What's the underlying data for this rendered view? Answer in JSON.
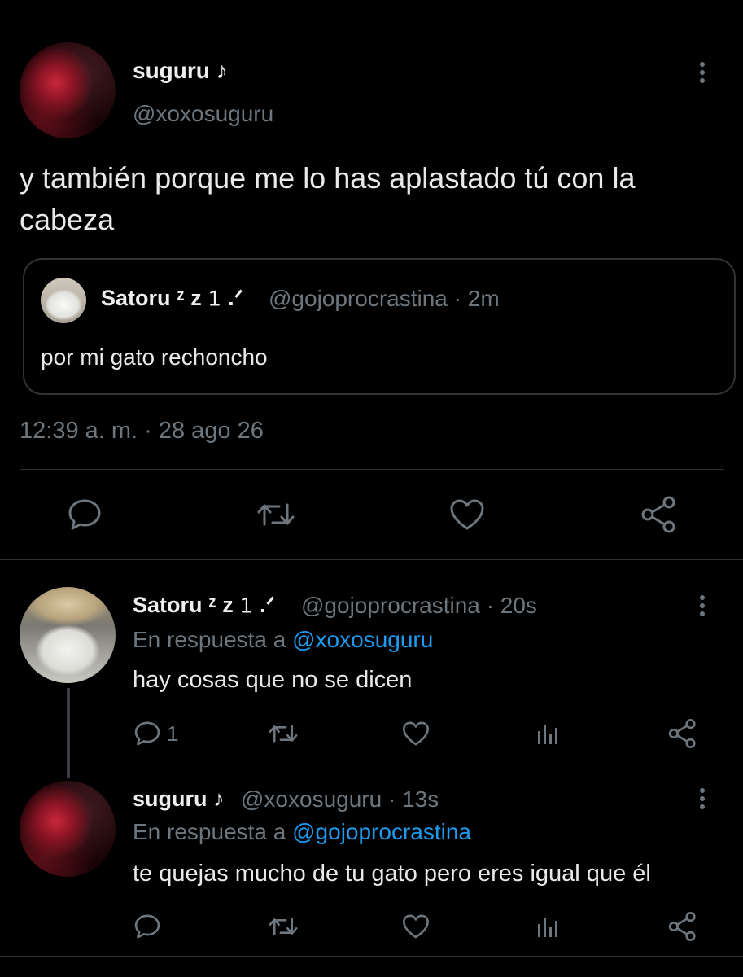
{
  "main_tweet": {
    "author_name": "suguru ♪",
    "author_handle": "@xoxosuguru",
    "text": "y también porque me lo has aplastado tú con la cabeza",
    "timestamp": "12:39 a. m. · 28 ago 26",
    "quoted": {
      "author_name": "Satoru ᶻ z 𝟷 .ᐟ",
      "meta": "@gojoprocrastina · 2m",
      "text": "por mi gato rechoncho"
    },
    "actions": [
      "reply-icon",
      "retweet-icon",
      "like-icon",
      "share-icon"
    ]
  },
  "replies": [
    {
      "author_name": "Satoru ᶻ z 𝟷 .ᐟ",
      "meta": "@gojoprocrastina · 20s",
      "reply_prefix": "En respuesta a",
      "reply_to": "@xoxosuguru",
      "text": "hay cosas que no se dicen",
      "reply_count": "1"
    },
    {
      "author_name": "suguru ♪",
      "meta": "@xoxosuguru · 13s",
      "reply_prefix": "En respuesta a",
      "reply_to": "@gojoprocrastina",
      "text": "te quejas mucho de tu gato pero eres igual que él",
      "reply_count": ""
    }
  ],
  "colors": {
    "background": "#000000",
    "muted": "#6e767d",
    "link": "#1d9bf0",
    "divider": "#2f3336"
  }
}
